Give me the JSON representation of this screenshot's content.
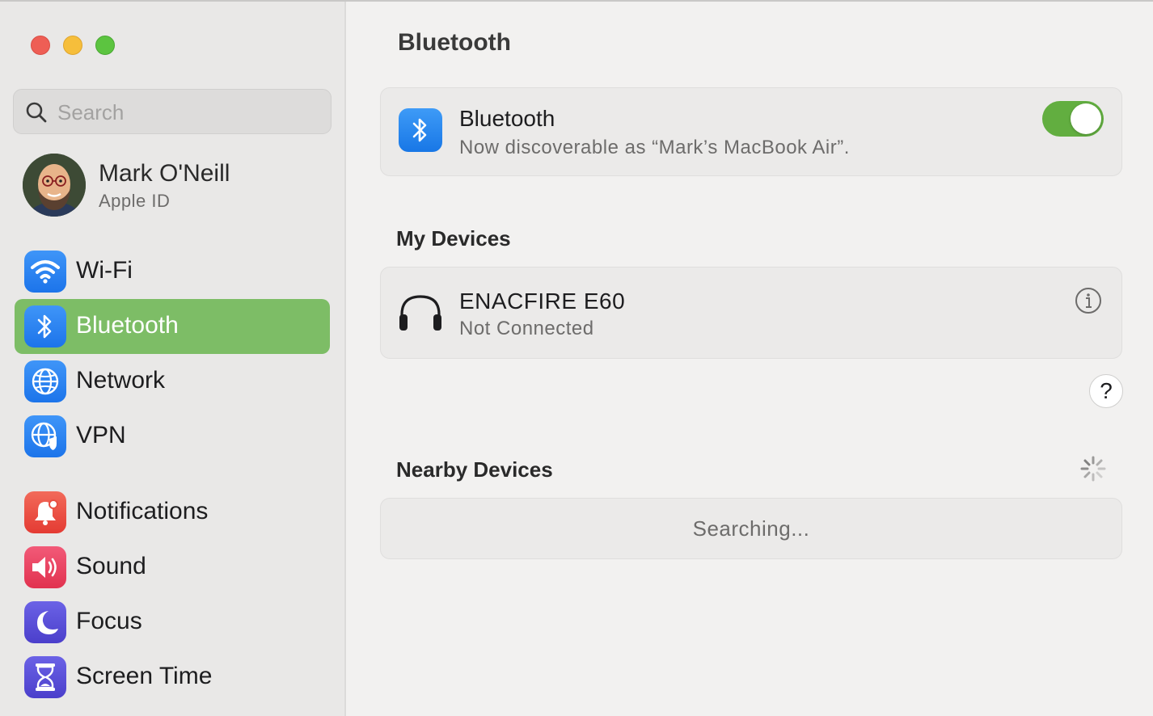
{
  "sidebar": {
    "search": {
      "placeholder": "Search",
      "value": ""
    },
    "profile": {
      "name": "Mark O'Neill",
      "subtitle": "Apple ID"
    },
    "items": [
      {
        "label": "Wi-Fi",
        "icon": "wifi-icon",
        "color": "#2f7df5"
      },
      {
        "label": "Bluetooth",
        "icon": "bluetooth-icon",
        "color": "#2f7df5",
        "selected": true
      },
      {
        "label": "Network",
        "icon": "globe-icon",
        "color": "#2f7df5"
      },
      {
        "label": "VPN",
        "icon": "vpn-globe-icon",
        "color": "#2f7df5"
      },
      {
        "label": "Notifications",
        "icon": "bell-icon",
        "color": "#ea4a3c"
      },
      {
        "label": "Sound",
        "icon": "speaker-icon",
        "color": "#ea3c5a"
      },
      {
        "label": "Focus",
        "icon": "moon-icon",
        "color": "#5b50d6"
      },
      {
        "label": "Screen Time",
        "icon": "hourglass-icon",
        "color": "#5b50d6"
      }
    ],
    "selected_color": "#7dbd66"
  },
  "main": {
    "title": "Bluetooth",
    "bluetooth": {
      "label": "Bluetooth",
      "status": "Now discoverable as “Mark’s MacBook Air”.",
      "enabled": true,
      "toggle_color": "#62ae40"
    },
    "my_devices": {
      "title": "My Devices",
      "devices": [
        {
          "name": "ENACFIRE E60",
          "status": "Not Connected",
          "icon": "headphones-icon"
        }
      ]
    },
    "help_label": "?",
    "nearby_devices": {
      "title": "Nearby Devices",
      "status": "Searching..."
    }
  }
}
